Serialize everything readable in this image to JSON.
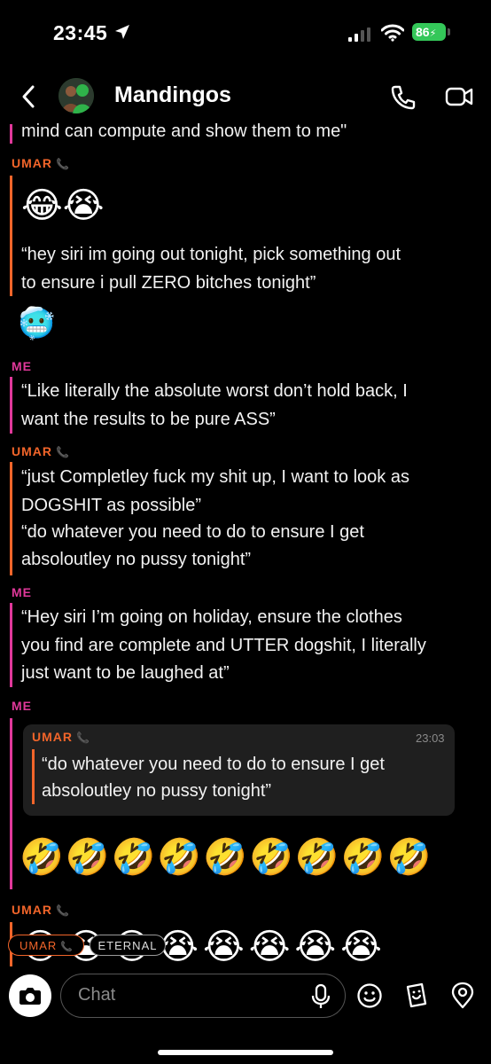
{
  "status_bar": {
    "time": "23:45",
    "battery": "86"
  },
  "header": {
    "title": "Mandingos"
  },
  "messages": {
    "m0_text": "mind can compute and show them to me\"",
    "g1_sender": "UMAR",
    "g1_emoji": "😂😭",
    "g1_text1": "“hey siri im going out tonight, pick something out",
    "g1_text2": "to ensure i pull ZERO bitches tonight”",
    "g1_reaction": "🥶",
    "g2_sender": "ME",
    "g2_text1": "“Like literally the absolute worst don’t hold back, I",
    "g2_text2": "want the results to be pure ASS”",
    "g3_sender": "UMAR",
    "g3_text1": "“just Completley fuck my shit up, I want to look as",
    "g3_text2": "DOGSHIT as possible”",
    "g3_text3": "“do whatever you need to do to ensure I get",
    "g3_text4": "absoloutley no pussy tonight”",
    "g4_sender": "ME",
    "g4_text1": "“Hey siri I’m going on holiday, ensure the clothes",
    "g4_text2": "you find are complete and UTTER dogshit, I literally",
    "g4_text3": "just want to be laughed at”",
    "g5_sender": "ME",
    "quote_sender": "UMAR",
    "quote_time": "23:03",
    "quote_text1": "“do whatever you need to do to ensure I get",
    "quote_text2": "absoloutley no pussy tonight”",
    "g5_emoji": "🤣🤣🤣🤣🤣🤣🤣🤣🤣",
    "g6_sender": "UMAR",
    "g6_emoji": "😭😭😭😭😭😭😭😭"
  },
  "pills": {
    "umar": "UMAR",
    "eternal": "ETERNAL"
  },
  "chat_input": {
    "placeholder": "Chat"
  }
}
